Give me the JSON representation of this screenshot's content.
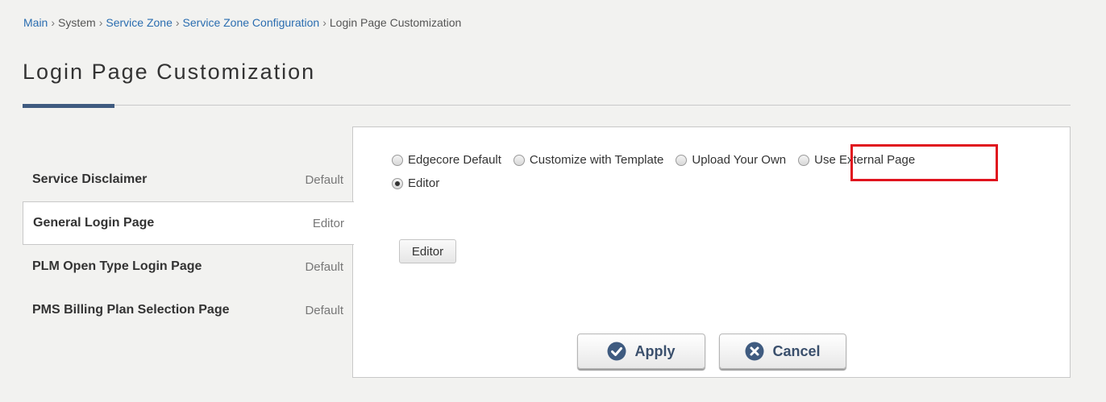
{
  "breadcrumb": {
    "main": "Main",
    "system": "System",
    "service_zone": "Service Zone",
    "service_zone_configuration": "Service Zone Configuration",
    "current": "Login Page Customization",
    "separator": "›"
  },
  "page": {
    "title": "Login Page Customization"
  },
  "sidebar": {
    "items": [
      {
        "label": "Service Disclaimer",
        "value": "Default"
      },
      {
        "label": "General Login Page",
        "value": "Editor"
      },
      {
        "label": "PLM Open Type Login Page",
        "value": "Default"
      },
      {
        "label": "PMS Billing Plan Selection Page",
        "value": "Default"
      }
    ],
    "active_index": 1
  },
  "options": {
    "edgecore_default": "Edgecore Default",
    "customize_template": "Customize with Template",
    "upload_own": "Upload Your Own",
    "use_external": "Use External Page",
    "editor": "Editor",
    "selected": "Editor"
  },
  "editor_button": {
    "label": "Editor"
  },
  "actions": {
    "apply_label": "Apply",
    "cancel_label": "Cancel"
  },
  "colors": {
    "accent": "#3f5b80",
    "link": "#2a6db0",
    "highlight": "#e0141e",
    "button_text": "#3a4f6c"
  },
  "icons": {
    "apply": "check-circle-icon",
    "cancel": "x-circle-icon"
  }
}
